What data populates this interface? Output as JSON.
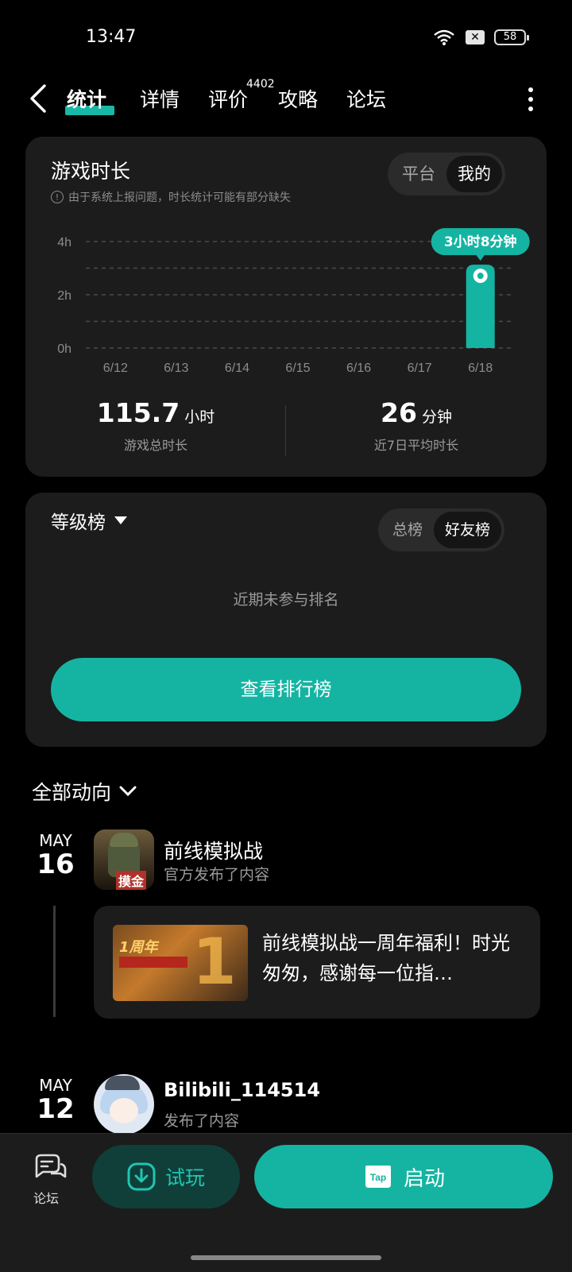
{
  "status": {
    "time": "13:47",
    "battery": "58"
  },
  "nav": {
    "tabs": [
      {
        "label": "统计",
        "active": true
      },
      {
        "label": "详情"
      },
      {
        "label": "评价",
        "badge": "4402"
      },
      {
        "label": "攻略"
      },
      {
        "label": "论坛"
      }
    ]
  },
  "playtime": {
    "title": "游戏时长",
    "notice": "由于系统上报问题，时长统计可能有部分缺失",
    "toggle": [
      "平台",
      "我的"
    ],
    "toggle_active": "我的",
    "total_value": "115.7",
    "total_unit": "小时",
    "total_label": "游戏总时长",
    "avg_value": "26",
    "avg_unit": "分钟",
    "avg_label": "近7日平均时长"
  },
  "chart_data": {
    "type": "bar",
    "categories": [
      "6/12",
      "6/13",
      "6/14",
      "6/15",
      "6/16",
      "6/17",
      "6/18"
    ],
    "values": [
      0,
      0,
      0,
      0,
      0,
      0,
      3.13
    ],
    "y_ticks": [
      "4h",
      "2h",
      "0h"
    ],
    "ylim": [
      0,
      4
    ],
    "tooltip": "3小时8分钟",
    "tooltip_category": "6/18",
    "bar_color": "#15b4a2"
  },
  "ranking": {
    "title": "等级榜",
    "toggle": [
      "总榜",
      "好友榜"
    ],
    "toggle_active": "好友榜",
    "empty_text": "近期未参与排名",
    "button": "查看排行榜"
  },
  "feed": {
    "title": "全部动向",
    "items": [
      {
        "month": "MAY",
        "day": "16",
        "name": "前线模拟战",
        "action": "官方发布了内容",
        "avatar_tag": "摸金",
        "post_text": "前线模拟战一周年福利！时光匆匆，感谢每一位指…",
        "thumb_banner": "1周年"
      },
      {
        "month": "MAY",
        "day": "12",
        "name": "Bilibili_114514",
        "action": "发布了内容"
      }
    ]
  },
  "bottom": {
    "forum": "论坛",
    "try": "试玩",
    "launch": "启动",
    "launch_logo": "Tap"
  },
  "colors": {
    "accent": "#15b4a2",
    "card": "#1c1c1c",
    "background": "#000000"
  }
}
